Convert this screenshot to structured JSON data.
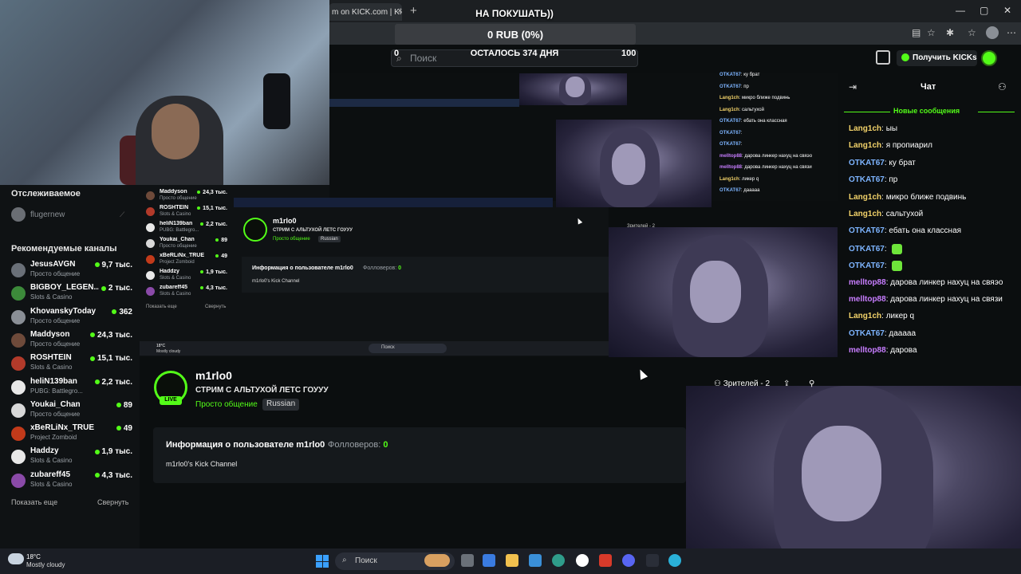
{
  "browser": {
    "tab_title": "m on KICK.com | Kick",
    "tab_close": "×",
    "new_tab": "+",
    "win_min": "—",
    "win_max": "▢",
    "win_close": "✕"
  },
  "donation": {
    "title": "НА ПОКУШАТЬ))",
    "amount": "0 RUB (0%)",
    "remaining": "ОСТАЛОСЬ 374 ДНЯ",
    "min": "0",
    "max": "100"
  },
  "header": {
    "search_placeholder": "Поиск",
    "kicks_button": "Получить KICKs"
  },
  "sidebar": {
    "following_title": "Отслеживаемое",
    "following_user": "flugernew",
    "recommended_title": "Рекомендуемые каналы",
    "channels": [
      {
        "name": "JesusAVGN",
        "category": "Просто общение",
        "viewers": "9,7 тыс.",
        "color": "#6a7078"
      },
      {
        "name": "BIGBOY_LEGEN...",
        "category": "Slots & Casino",
        "viewers": "2 тыс.",
        "color": "#3c8a3a"
      },
      {
        "name": "KhovanskyToday",
        "category": "Просто общение",
        "viewers": "362",
        "color": "#8a8f96"
      },
      {
        "name": "Maddyson",
        "category": "Просто общение",
        "viewers": "24,3 тыс.",
        "color": "#6e4a3a"
      },
      {
        "name": "ROSHTEIN",
        "category": "Slots & Casino",
        "viewers": "15,1 тыс.",
        "color": "#b23a2a"
      },
      {
        "name": "heliN139ban",
        "category": "PUBG: Battlegro...",
        "viewers": "2,2 тыс.",
        "color": "#e8e8e8"
      },
      {
        "name": "Youkai_Chan",
        "category": "Просто общение",
        "viewers": "89",
        "color": "#d8d8d8"
      },
      {
        "name": "xBeRLiNx_TRUE",
        "category": "Project Zomboid",
        "viewers": "49",
        "color": "#c23a1a"
      },
      {
        "name": "Haddzy",
        "category": "Slots & Casino",
        "viewers": "1,9 тыс.",
        "color": "#e8e8e8"
      },
      {
        "name": "zubareff45",
        "category": "Slots & Casino",
        "viewers": "4,3 тыс.",
        "color": "#8a4aa8"
      }
    ],
    "show_more": "Показать еще",
    "collapse": "Свернуть"
  },
  "nested": {
    "channel_name": "m1rlo0",
    "stream_title": "СТРИМ С АЛЬТУХОЙ ЛЕТС ГОУУУ",
    "category": "Просто общение",
    "tag": "Russian",
    "about_title": "Информация о пользователе m1rlo0",
    "followers_label": "Фолловеров:",
    "followers": "0",
    "about_desc": "m1rlo0's Kick Channel",
    "weather_temp": "18°C",
    "weather_desc": "Mostly cloudy",
    "taskbar_search": "Поиск",
    "viewers": "Зрителей - 2"
  },
  "stream": {
    "channel_name": "m1rlo0",
    "live": "LIVE",
    "title": "СТРИМ С АЛЬТУХОЙ ЛЕТС ГОУУУ",
    "category": "Просто общение",
    "tag": "Russian",
    "viewers": "Зрителей - 2",
    "about_title": "Информация о пользователе m1rlo0",
    "followers_label": "Фолловеров:",
    "followers": "0",
    "about_desc": "m1rlo0's Kick Channel"
  },
  "chat": {
    "title": "Чат",
    "new_messages": "Новые сообщения",
    "messages": [
      {
        "user": "Lang1ch",
        "text": "ыы",
        "color": "#f3d36a",
        "emote": false
      },
      {
        "user": "Lang1ch",
        "text": "я пропиарил",
        "color": "#f3d36a",
        "emote": false
      },
      {
        "user": "OTKAT67",
        "text": "ку брат",
        "color": "#7db4ff",
        "emote": false
      },
      {
        "user": "OTKAT67",
        "text": "пр",
        "color": "#7db4ff",
        "emote": false
      },
      {
        "user": "Lang1ch",
        "text": "микро ближе подвинь",
        "color": "#f3d36a",
        "emote": false
      },
      {
        "user": "Lang1ch",
        "text": "сальтухой",
        "color": "#f3d36a",
        "emote": false
      },
      {
        "user": "OTKAT67",
        "text": "ебать она классная",
        "color": "#7db4ff",
        "emote": false
      },
      {
        "user": "OTKAT67",
        "text": "",
        "color": "#7db4ff",
        "emote": true
      },
      {
        "user": "OTKAT67",
        "text": "",
        "color": "#7db4ff",
        "emote": true
      },
      {
        "user": "melltop88",
        "text": "дарова линкер нахуц на свяэо",
        "color": "#c77dff",
        "emote": false
      },
      {
        "user": "melltop88",
        "text": "дарова линкер нахуц на связи",
        "color": "#c77dff",
        "emote": false
      },
      {
        "user": "Lang1ch",
        "text": "ликер q",
        "color": "#f3d36a",
        "emote": false
      },
      {
        "user": "OTKAT67",
        "text": "дааааа",
        "color": "#7db4ff",
        "emote": false
      },
      {
        "user": "melltop88",
        "text": "дарова",
        "color": "#c77dff",
        "emote": false
      }
    ]
  },
  "nested_chat": [
    {
      "user": "OTKAT67",
      "text": "ку брат",
      "color": "#7db4ff"
    },
    {
      "user": "OTKAT67",
      "text": "пр",
      "color": "#7db4ff"
    },
    {
      "user": "Lang1ch",
      "text": "микро ближе подвинь",
      "color": "#f3d36a"
    },
    {
      "user": "Lang1ch",
      "text": "сальтухой",
      "color": "#f3d36a"
    },
    {
      "user": "OTKAT67",
      "text": "ебать она классная",
      "color": "#7db4ff"
    },
    {
      "user": "OTKAT67",
      "text": "",
      "color": "#7db4ff"
    },
    {
      "user": "OTKAT67",
      "text": "",
      "color": "#7db4ff"
    },
    {
      "user": "melltop88",
      "text": "дарова линкер нахуц на свяэо",
      "color": "#c77dff"
    },
    {
      "user": "melltop88",
      "text": "дарова линкер нахуц на связи",
      "color": "#c77dff"
    },
    {
      "user": "Lang1ch",
      "text": "ликер q",
      "color": "#f3d36a"
    },
    {
      "user": "OTKAT67",
      "text": "дааааа",
      "color": "#7db4ff"
    }
  ],
  "taskbar": {
    "weather_temp": "18°C",
    "weather_desc": "Mostly cloudy",
    "search": "Поиск"
  }
}
